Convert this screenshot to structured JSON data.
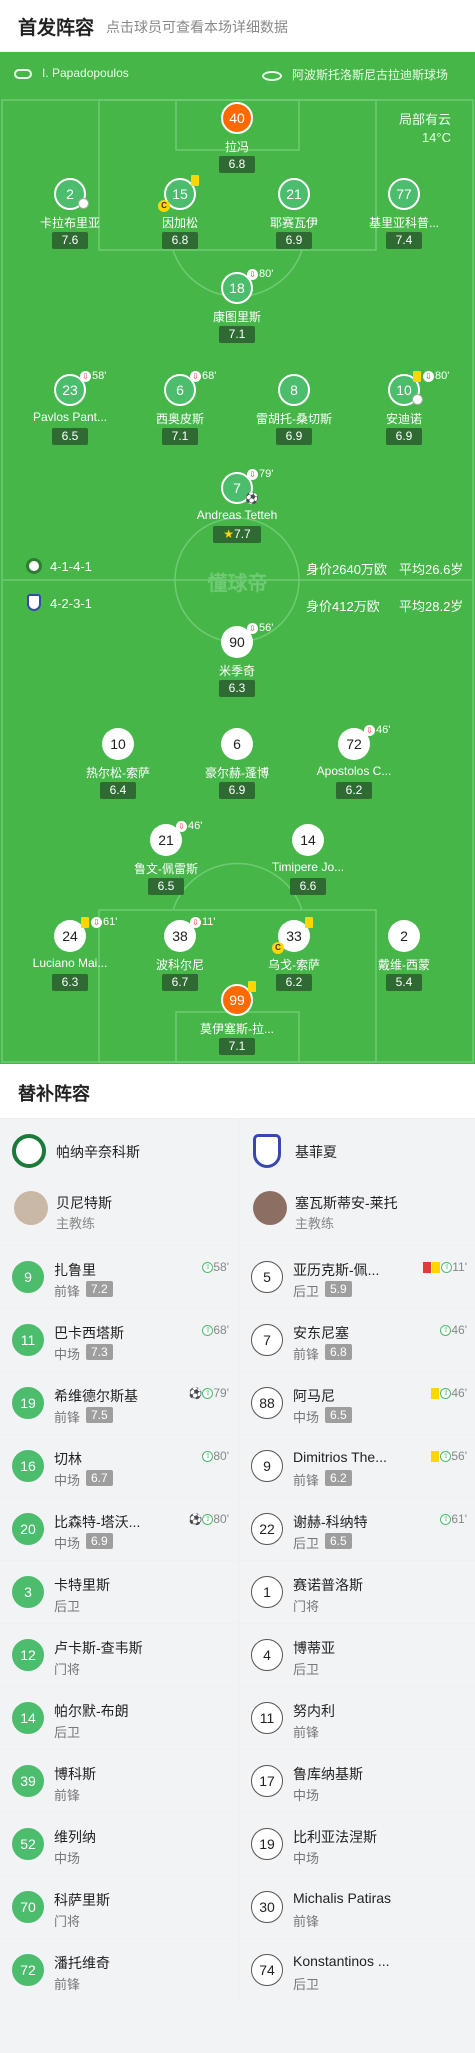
{
  "header": {
    "title": "首发阵容",
    "hint": "点击球员可查看本场详细数据"
  },
  "match_info": {
    "referee": "I. Papadopoulos",
    "stadium": "阿波斯托洛斯尼古拉迪斯球场",
    "weather": "局部有云",
    "temperature": "14°C",
    "watermark": "懂球帝"
  },
  "teams": {
    "home": {
      "formation": "4-1-4-1",
      "value": "身价2640万欧",
      "age": "平均26.6岁"
    },
    "away": {
      "formation": "4-2-3-1",
      "value": "身价412万欧",
      "age": "平均28.2岁"
    }
  },
  "home_lineup": [
    {
      "number": "40",
      "name": "拉冯",
      "rating": "6.8"
    },
    {
      "number": "2",
      "name": "卡拉布里亚",
      "rating": "7.6"
    },
    {
      "number": "15",
      "name": "因加松",
      "rating": "6.8"
    },
    {
      "number": "21",
      "name": "耶赛瓦伊",
      "rating": "6.9"
    },
    {
      "number": "77",
      "name": "基里亚科普...",
      "rating": "7.4"
    },
    {
      "number": "18",
      "name": "康图里斯",
      "rating": "7.1",
      "sub": "80'"
    },
    {
      "number": "23",
      "name": "Pavlos Pant...",
      "rating": "6.5",
      "sub": "58'"
    },
    {
      "number": "6",
      "name": "西奥皮斯",
      "rating": "7.1",
      "sub": "68'"
    },
    {
      "number": "8",
      "name": "雷胡托-桑切斯",
      "rating": "6.9"
    },
    {
      "number": "10",
      "name": "安迪诺",
      "rating": "6.9",
      "sub": "80'"
    },
    {
      "number": "7",
      "name": "Andreas Tetteh",
      "rating": "7.7",
      "sub": "79'"
    }
  ],
  "away_lineup": [
    {
      "number": "90",
      "name": "米季奇",
      "rating": "6.3",
      "sub": "56'"
    },
    {
      "number": "10",
      "name": "热尔松-索萨",
      "rating": "6.4"
    },
    {
      "number": "6",
      "name": "豪尔赫-蓬博",
      "rating": "6.9"
    },
    {
      "number": "72",
      "name": "Apostolos C...",
      "rating": "6.2",
      "sub": "46'"
    },
    {
      "number": "21",
      "name": "鲁文-佩雷斯",
      "rating": "6.5",
      "sub": "46'"
    },
    {
      "number": "14",
      "name": "Timipere Jo...",
      "rating": "6.6"
    },
    {
      "number": "24",
      "name": "Luciano Mai...",
      "rating": "6.3",
      "sub": "61'"
    },
    {
      "number": "38",
      "name": "波科尔尼",
      "rating": "6.7",
      "sub": "11'"
    },
    {
      "number": "33",
      "name": "乌戈-索萨",
      "rating": "6.2"
    },
    {
      "number": "2",
      "name": "戴维-西蒙",
      "rating": "5.4"
    },
    {
      "number": "99",
      "name": "莫伊塞斯-拉...",
      "rating": "7.1"
    }
  ],
  "subs": {
    "title": "替补阵容",
    "home_team": "帕纳辛奈科斯",
    "away_team": "基菲夏",
    "home_coach": {
      "name": "贝尼特斯",
      "role": "主教练"
    },
    "away_coach": {
      "name": "塞瓦斯蒂安-莱托",
      "role": "主教练"
    },
    "home": [
      {
        "number": "9",
        "name": "扎鲁里",
        "pos": "前锋",
        "rating": "7.2",
        "time": "58'"
      },
      {
        "number": "11",
        "name": "巴卡西塔斯",
        "pos": "中场",
        "rating": "7.3",
        "time": "68'"
      },
      {
        "number": "19",
        "name": "希维德尔斯基",
        "pos": "前锋",
        "rating": "7.5",
        "time": "79'"
      },
      {
        "number": "16",
        "name": "切林",
        "pos": "中场",
        "rating": "6.7",
        "time": "80'"
      },
      {
        "number": "20",
        "name": "比森特-塔沃...",
        "pos": "中场",
        "rating": "6.9",
        "time": "80'"
      },
      {
        "number": "3",
        "name": "卡特里斯",
        "pos": "后卫",
        "rating": "",
        "time": ""
      },
      {
        "number": "12",
        "name": "卢卡斯-查韦斯",
        "pos": "门将",
        "rating": "",
        "time": ""
      },
      {
        "number": "14",
        "name": "帕尔默-布朗",
        "pos": "后卫",
        "rating": "",
        "time": ""
      },
      {
        "number": "39",
        "name": "博科斯",
        "pos": "前锋",
        "rating": "",
        "time": ""
      },
      {
        "number": "52",
        "name": "维列纳",
        "pos": "中场",
        "rating": "",
        "time": ""
      },
      {
        "number": "70",
        "name": "科萨里斯",
        "pos": "门将",
        "rating": "",
        "time": ""
      },
      {
        "number": "72",
        "name": "潘托维奇",
        "pos": "前锋",
        "rating": "",
        "time": ""
      }
    ],
    "away": [
      {
        "number": "5",
        "name": "亚历克斯-佩...",
        "pos": "后卫",
        "rating": "5.9",
        "time": "11'"
      },
      {
        "number": "7",
        "name": "安东尼塞",
        "pos": "前锋",
        "rating": "6.8",
        "time": "46'"
      },
      {
        "number": "88",
        "name": "阿马尼",
        "pos": "中场",
        "rating": "6.5",
        "time": "46'"
      },
      {
        "number": "9",
        "name": "Dimitrios The...",
        "pos": "前锋",
        "rating": "6.2",
        "time": "56'"
      },
      {
        "number": "22",
        "name": "谢赫-科纳特",
        "pos": "后卫",
        "rating": "6.5",
        "time": "61'"
      },
      {
        "number": "1",
        "name": "赛诺普洛斯",
        "pos": "门将",
        "rating": "",
        "time": ""
      },
      {
        "number": "4",
        "name": "博蒂亚",
        "pos": "后卫",
        "rating": "",
        "time": ""
      },
      {
        "number": "11",
        "name": "努内利",
        "pos": "前锋",
        "rating": "",
        "time": ""
      },
      {
        "number": "17",
        "name": "鲁库纳基斯",
        "pos": "中场",
        "rating": "",
        "time": ""
      },
      {
        "number": "19",
        "name": "比利亚法涅斯",
        "pos": "中场",
        "rating": "",
        "time": ""
      },
      {
        "number": "30",
        "name": "Michalis Patiras",
        "pos": "前锋",
        "rating": "",
        "time": ""
      },
      {
        "number": "74",
        "name": "Konstantinos ...",
        "pos": "后卫",
        "rating": "",
        "time": ""
      }
    ]
  },
  "colors": {
    "pitch": "#46b649",
    "home_accent": "#4cbc6d",
    "keeper": "#ff6a00",
    "rating_bg": "#2f6a33"
  }
}
